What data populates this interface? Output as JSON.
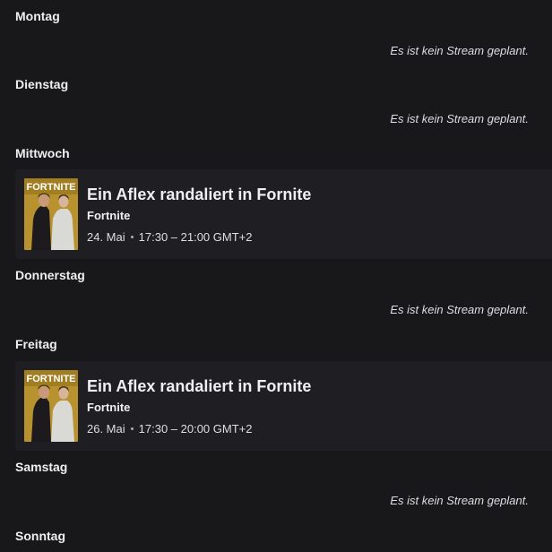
{
  "schedule": {
    "days": [
      {
        "name": "Montag"
      },
      {
        "name": "Dienstag"
      },
      {
        "name": "Mittwoch"
      },
      {
        "name": "Donnerstag"
      },
      {
        "name": "Freitag"
      },
      {
        "name": "Samstag"
      },
      {
        "name": "Sonntag"
      }
    ],
    "no_stream_text": "Es ist kein Stream geplant.",
    "streams": [
      {
        "title": "Ein Aflex randaliert in Fornite",
        "game": "Fortnite",
        "date": "24. Mai",
        "time_range": "17:30 – 21:00 GMT+2",
        "box_art_text": "FORTNITE"
      },
      {
        "title": "Ein Aflex randaliert in Fornite",
        "game": "Fortnite",
        "date": "26. Mai",
        "time_range": "17:30 – 20:00 GMT+2",
        "box_art_text": "FORTNITE"
      }
    ]
  },
  "colors": {
    "background": "#18181b",
    "card_background": "#1f1f23",
    "text_primary": "#efeff1",
    "text_secondary": "#dedee3",
    "box_art_gold": "#b8922e"
  }
}
